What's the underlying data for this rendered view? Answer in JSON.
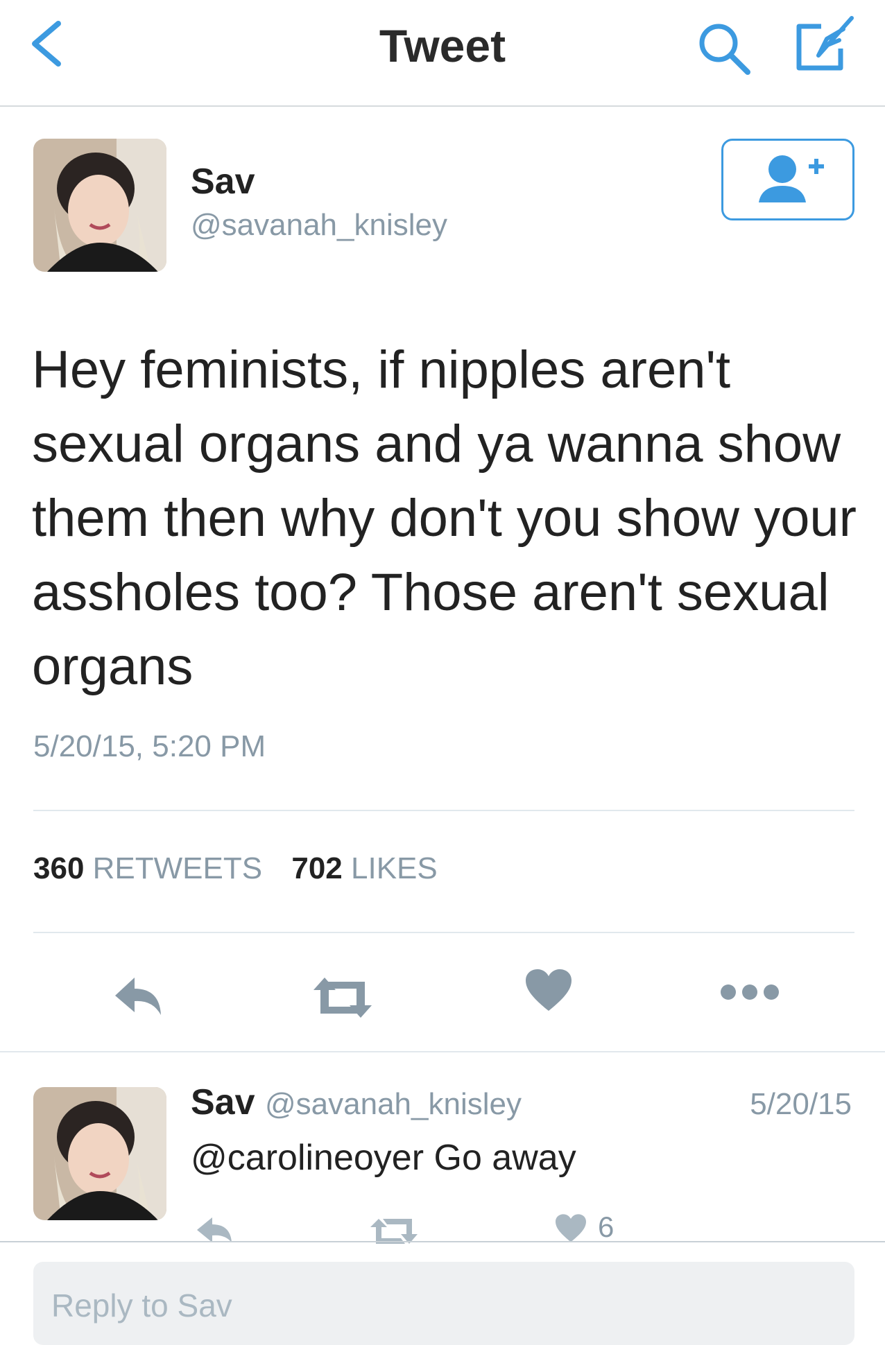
{
  "header": {
    "title": "Tweet"
  },
  "tweet": {
    "author_name": "Sav",
    "author_handle": "@savanah_knisley",
    "text": "Hey feminists, if nipples aren't sexual organs and ya wanna show them then why don't you show your assholes too? Those aren't sexual organs",
    "timestamp": "5/20/15, 5:20 PM",
    "retweet_count": "360",
    "retweet_label": "RETWEETS",
    "like_count": "702",
    "like_label": "LIKES"
  },
  "reply": {
    "author_name": "Sav",
    "author_handle": "@savanah_knisley",
    "date": "5/20/15",
    "text": "@carolineoyer Go away",
    "like_count": "6"
  },
  "composer": {
    "placeholder": "Reply to Sav"
  },
  "colors": {
    "accent": "#3c9ae0",
    "icon_gray": "#8899a6",
    "divider": "#e1e8ed"
  }
}
